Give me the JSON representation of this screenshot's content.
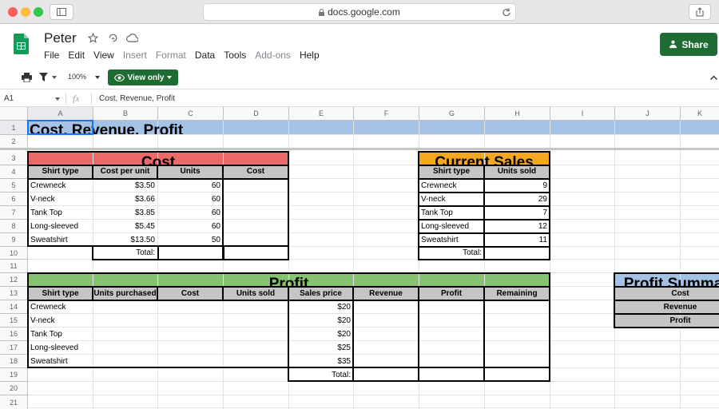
{
  "browser": {
    "url": "docs.google.com",
    "colors": {
      "close": "#fc605b",
      "minimize": "#fdbc40",
      "maximize": "#34c84a"
    }
  },
  "doc": {
    "title": "Peter",
    "menu": [
      "File",
      "Edit",
      "View",
      "Insert",
      "Format",
      "Data",
      "Tools",
      "Add-ons",
      "Help"
    ],
    "share_label": "Share"
  },
  "toolbar": {
    "zoom": "100%",
    "view_only": "View only"
  },
  "formula_bar": {
    "cell_ref": "A1",
    "fx": "fx",
    "content": "Cost, Revenue, Profit"
  },
  "columns": [
    "A",
    "B",
    "C",
    "D",
    "E",
    "F",
    "G",
    "H",
    "I",
    "J",
    "K"
  ],
  "rows": [
    "1",
    "2",
    "3",
    "4",
    "5",
    "6",
    "7",
    "8",
    "9",
    "10",
    "11",
    "12",
    "13",
    "14",
    "15",
    "16",
    "17",
    "18",
    "19",
    "20",
    "21"
  ],
  "sheet": {
    "title": "Cost, Revenue, Profit",
    "cost": {
      "title": "Cost",
      "headers": [
        "Shirt type",
        "Cost per unit",
        "Units",
        "Cost"
      ],
      "rows": [
        {
          "type": "Crewneck",
          "cost_per_unit": "$3.50",
          "units": "60"
        },
        {
          "type": "V-neck",
          "cost_per_unit": "$3.66",
          "units": "60"
        },
        {
          "type": "Tank Top",
          "cost_per_unit": "$3.85",
          "units": "60"
        },
        {
          "type": "Long-sleeved",
          "cost_per_unit": "$5.45",
          "units": "60"
        },
        {
          "type": "Sweatshirt",
          "cost_per_unit": "$13.50",
          "units": "50"
        }
      ],
      "total_label": "Total:"
    },
    "sales": {
      "title": "Current Sales",
      "headers": [
        "Shirt type",
        "Units sold"
      ],
      "rows": [
        {
          "type": "Crewneck",
          "units_sold": "9"
        },
        {
          "type": "V-neck",
          "units_sold": "29"
        },
        {
          "type": "Tank Top",
          "units_sold": "7"
        },
        {
          "type": "Long-sleeved",
          "units_sold": "12"
        },
        {
          "type": "Sweatshirt",
          "units_sold": "11"
        }
      ],
      "total_label": "Total:"
    },
    "profit": {
      "title": "Profit",
      "headers": [
        "Shirt type",
        "Units purchased",
        "Cost",
        "Units sold",
        "Sales price",
        "Revenue",
        "Profit",
        "Remaining"
      ],
      "rows": [
        {
          "type": "Crewneck",
          "price": "$20"
        },
        {
          "type": "V-neck",
          "price": "$20"
        },
        {
          "type": "Tank Top",
          "price": "$20"
        },
        {
          "type": "Long-sleeved",
          "price": "$25"
        },
        {
          "type": "Sweatshirt",
          "price": "$35"
        }
      ],
      "total_label": "Total:"
    },
    "summary": {
      "title": "Profit Summary",
      "rows": [
        "Cost",
        "Revenue",
        "Profit"
      ]
    }
  }
}
